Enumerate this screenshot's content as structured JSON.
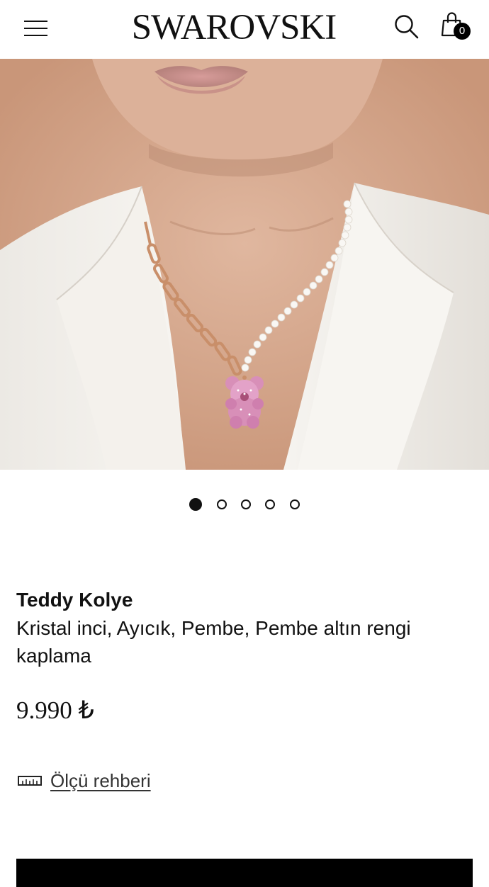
{
  "header": {
    "brand": "SWAROVSKI",
    "menu_icon": "hamburger-menu-icon",
    "search_icon": "search-icon",
    "bag_icon": "shopping-bag-icon",
    "bag_count": "0"
  },
  "gallery": {
    "image_description": "Model wearing Teddy necklace with half pearl, half rose gold chain and pink crystal teddy bear pendant",
    "total_slides": 5,
    "active_slide": 1
  },
  "product": {
    "name": "Teddy Kolye",
    "description": "Kristal inci, Ayıcık, Pembe, Pembe altın rengi kaplama",
    "price": "9.990 ₺"
  },
  "size_guide": {
    "label": "Ölçü rehberi",
    "icon": "ruler-icon"
  },
  "colors": {
    "primary": "#000000",
    "background": "#ffffff",
    "text": "#111111"
  }
}
